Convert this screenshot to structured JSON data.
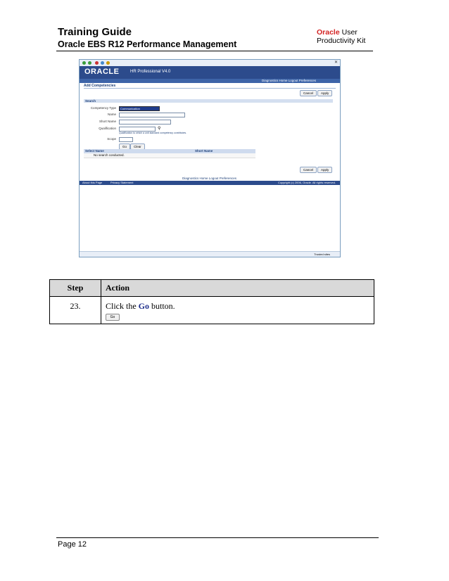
{
  "header": {
    "title": "Training Guide",
    "subtitle": "Oracle EBS R12 Performance Management",
    "upk_oracle": "Oracle",
    "upk_user": "User",
    "upk_line2": "Productivity Kit"
  },
  "screenshot": {
    "brand_logo": "ORACLE",
    "app_title": "HR Professional V4.0",
    "global_nav": "Diagnostics  Home  Logout  Preferences",
    "page_heading": "Add Competencies",
    "cancel_label": "Cancel",
    "apply_label": "Apply",
    "search_header": "Search",
    "competency_type_label": "Competency Type",
    "competency_type_value": "Communication",
    "name_label": "Name",
    "short_name_label": "Short Name",
    "qualification_label": "Qualification",
    "qualification_hint": "Qualification to which a unit standard competency contributes.",
    "scope_label": "Scope",
    "go_label": "Go",
    "clear_label": "Clear",
    "col_select_name": "Select Name",
    "col_short_name": "Short Name",
    "empty_row": "No search conducted.",
    "footer_nav": "Diagnostics  Home  Logout  Preferences",
    "about": "About this Page",
    "privacy": "Privacy Statement",
    "copyright": "Copyright (c) 2006, Oracle. All rights reserved.",
    "status_trusted": "Trusted sites"
  },
  "steps": {
    "col_step": "Step",
    "col_action": "Action",
    "rows": [
      {
        "step": "23.",
        "action_pre": "Click the ",
        "action_bold": "Go",
        "action_post": " button.",
        "button_label": "Go"
      }
    ]
  },
  "footer": {
    "page": "Page 12"
  }
}
